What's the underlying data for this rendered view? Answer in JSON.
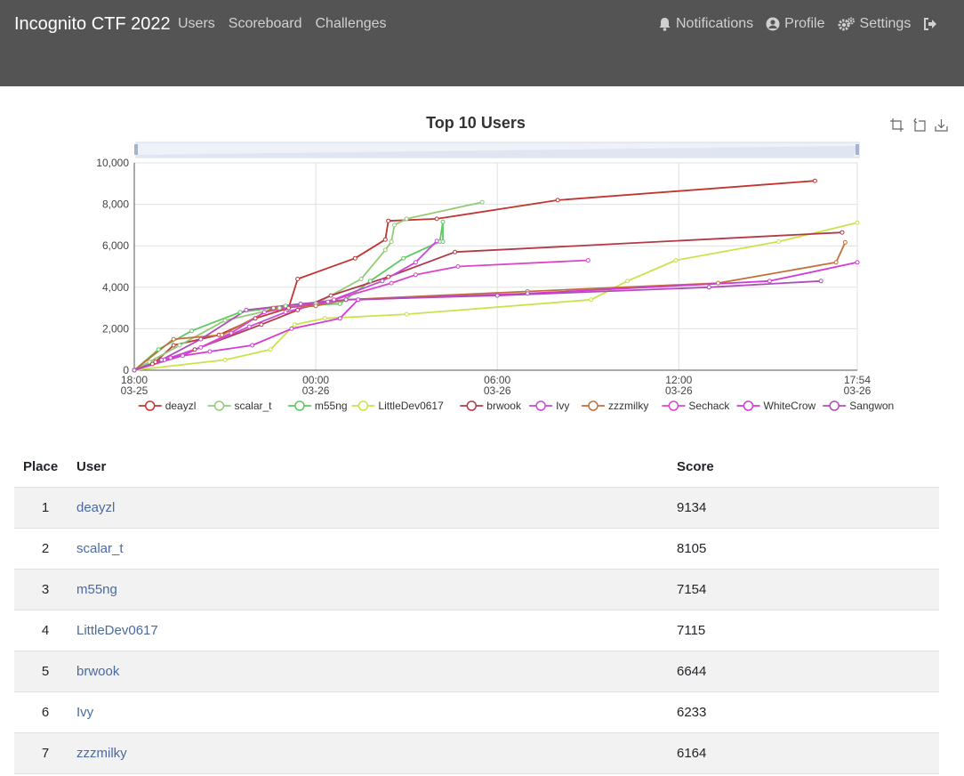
{
  "nav": {
    "brand": "Incognito CTF 2022",
    "left_items": [
      "Users",
      "Scoreboard",
      "Challenges"
    ],
    "notifications": "Notifications",
    "profile": "Profile",
    "settings": "Settings"
  },
  "chart_data": {
    "type": "line",
    "title": "Top 10 Users",
    "ylim": [
      0,
      10000
    ],
    "yticks": [
      "0",
      "2,000",
      "4,000",
      "6,000",
      "8,000",
      "10,000"
    ],
    "x_range_hours": [
      18,
      41.9
    ],
    "xticks": [
      {
        "h": 18,
        "time": "18:00",
        "date": "03-25"
      },
      {
        "h": 24,
        "time": "00:00",
        "date": "03-26"
      },
      {
        "h": 30,
        "time": "06:00",
        "date": "03-26"
      },
      {
        "h": 36,
        "time": "12:00",
        "date": "03-26"
      },
      {
        "h": 41.9,
        "time": "17:54",
        "date": "03-26"
      }
    ],
    "grid": true,
    "legend_position": "bottom",
    "series": [
      {
        "name": "deayzl",
        "color": "#c23531",
        "points": [
          [
            18,
            0
          ],
          [
            18.7,
            400
          ],
          [
            19.3,
            1200
          ],
          [
            20.8,
            1700
          ],
          [
            22.0,
            2500
          ],
          [
            23.1,
            3000
          ],
          [
            23.4,
            4400
          ],
          [
            25.3,
            5400
          ],
          [
            26.3,
            6300
          ],
          [
            26.4,
            7200
          ],
          [
            28.0,
            7300
          ],
          [
            32.0,
            8200
          ],
          [
            40.5,
            9134
          ]
        ]
      },
      {
        "name": "scalar_t",
        "color": "#91cc75",
        "points": [
          [
            18,
            0
          ],
          [
            18.5,
            400
          ],
          [
            19.5,
            1200
          ],
          [
            21.0,
            2400
          ],
          [
            22.8,
            3000
          ],
          [
            24.0,
            3200
          ],
          [
            25.5,
            4400
          ],
          [
            26.3,
            5800
          ],
          [
            26.5,
            6200
          ],
          [
            26.6,
            7000
          ],
          [
            27.0,
            7300
          ],
          [
            29.5,
            8105
          ]
        ]
      },
      {
        "name": "m55ng",
        "color": "#5ec962",
        "points": [
          [
            18,
            0
          ],
          [
            18.8,
            1000
          ],
          [
            19.9,
            1900
          ],
          [
            21.5,
            2800
          ],
          [
            23.0,
            3100
          ],
          [
            24.8,
            3200
          ],
          [
            25.8,
            4300
          ],
          [
            26.9,
            5400
          ],
          [
            28.1,
            6200
          ],
          [
            28.2,
            7154
          ],
          [
            28.2,
            6200
          ]
        ]
      },
      {
        "name": "LittleDev0617",
        "color": "#c8e44a",
        "points": [
          [
            18,
            0
          ],
          [
            21.0,
            500
          ],
          [
            22.5,
            1000
          ],
          [
            23.3,
            2200
          ],
          [
            24.3,
            2500
          ],
          [
            27.0,
            2700
          ],
          [
            33.1,
            3400
          ],
          [
            34.3,
            4300
          ],
          [
            35.9,
            5300
          ],
          [
            39.3,
            6200
          ],
          [
            41.9,
            7115
          ]
        ]
      },
      {
        "name": "brwook",
        "color": "#b23a48",
        "points": [
          [
            18,
            0
          ],
          [
            18.6,
            300
          ],
          [
            20.0,
            1000
          ],
          [
            22.2,
            2200
          ],
          [
            23.4,
            2900
          ],
          [
            24.5,
            3600
          ],
          [
            26.4,
            4500
          ],
          [
            28.6,
            5700
          ],
          [
            41.4,
            6644
          ]
        ]
      },
      {
        "name": "Ivy",
        "color": "#c64bd6",
        "points": [
          [
            18,
            0
          ],
          [
            19.0,
            500
          ],
          [
            20.2,
            1100
          ],
          [
            21.8,
            2100
          ],
          [
            23.0,
            2800
          ],
          [
            24.4,
            3300
          ],
          [
            26.2,
            4300
          ],
          [
            27.3,
            5200
          ],
          [
            28.0,
            6233
          ]
        ]
      },
      {
        "name": "zzzmilky",
        "color": "#c0703a",
        "points": [
          [
            18,
            0
          ],
          [
            19.3,
            1500
          ],
          [
            20.9,
            1700
          ],
          [
            22.6,
            3000
          ],
          [
            24.0,
            3100
          ],
          [
            25.0,
            3400
          ],
          [
            31.0,
            3800
          ],
          [
            37.3,
            4200
          ],
          [
            41.2,
            5200
          ],
          [
            41.5,
            6164
          ]
        ]
      },
      {
        "name": "Sechack",
        "color": "#d946c8",
        "points": [
          [
            18,
            0
          ],
          [
            19.6,
            700
          ],
          [
            21.2,
            1800
          ],
          [
            22.3,
            2800
          ],
          [
            24.6,
            3400
          ],
          [
            26.5,
            4200
          ],
          [
            27.3,
            4600
          ],
          [
            28.7,
            5000
          ],
          [
            33.0,
            5300
          ]
        ]
      },
      {
        "name": "WhiteCrow",
        "color": "#d33ad6",
        "points": [
          [
            18,
            0
          ],
          [
            19.2,
            600
          ],
          [
            20.5,
            900
          ],
          [
            21.9,
            1200
          ],
          [
            23.2,
            2000
          ],
          [
            24.8,
            2500
          ],
          [
            25.4,
            3400
          ],
          [
            31.0,
            3700
          ],
          [
            39.0,
            4300
          ],
          [
            41.9,
            5200
          ]
        ]
      },
      {
        "name": "Sangwon",
        "color": "#b04db8",
        "points": [
          [
            18,
            0
          ],
          [
            18.9,
            500
          ],
          [
            20.2,
            1500
          ],
          [
            21.7,
            2900
          ],
          [
            23.5,
            3200
          ],
          [
            25.0,
            3400
          ],
          [
            30.0,
            3600
          ],
          [
            37.0,
            4000
          ],
          [
            40.7,
            4300
          ]
        ]
      }
    ]
  },
  "table": {
    "headers": {
      "place": "Place",
      "user": "User",
      "score": "Score"
    },
    "rows": [
      {
        "place": "1",
        "user": "deayzl",
        "score": "9134"
      },
      {
        "place": "2",
        "user": "scalar_t",
        "score": "8105"
      },
      {
        "place": "3",
        "user": "m55ng",
        "score": "7154"
      },
      {
        "place": "4",
        "user": "LittleDev0617",
        "score": "7115"
      },
      {
        "place": "5",
        "user": "brwook",
        "score": "6644"
      },
      {
        "place": "6",
        "user": "Ivy",
        "score": "6233"
      },
      {
        "place": "7",
        "user": "zzzmilky",
        "score": "6164"
      }
    ]
  },
  "icons": {
    "notifications": "bell-icon",
    "profile": "user-circle-icon",
    "settings": "cogs-icon",
    "logout": "sign-out-icon",
    "zoom": "zoom-icon",
    "zoom_reset": "zoom-reset-icon",
    "save": "download-icon"
  }
}
